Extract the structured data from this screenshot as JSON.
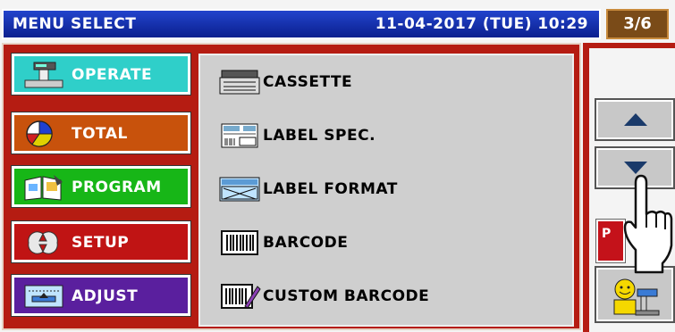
{
  "header": {
    "title": "MENU SELECT",
    "datetime": "11-04-2017 (TUE) 10:29",
    "page_indicator": "3/6"
  },
  "categories": [
    {
      "label": "OPERATE",
      "icon": "scale-icon",
      "color": "#2fcfc9"
    },
    {
      "label": "TOTAL",
      "icon": "pie-chart-icon",
      "color": "#c8520c"
    },
    {
      "label": "PROGRAM",
      "icon": "book-icon",
      "color": "#17b617"
    },
    {
      "label": "SETUP",
      "icon": "wrench-icon",
      "color": "#c01414"
    },
    {
      "label": "ADJUST",
      "icon": "calibration-icon",
      "color": "#5a1f9e"
    }
  ],
  "menu_items": [
    {
      "label": "CASSETTE",
      "icon": "cassette-icon"
    },
    {
      "label": "LABEL SPEC.",
      "icon": "label-spec-icon"
    },
    {
      "label": "LABEL FORMAT",
      "icon": "label-format-icon"
    },
    {
      "label": "BARCODE",
      "icon": "barcode-icon"
    },
    {
      "label": "CUSTOM BARCODE",
      "icon": "custom-barcode-icon"
    }
  ],
  "side_panel": {
    "up_icon": "arrow-up-icon",
    "down_icon": "arrow-down-icon",
    "partial_button_label": "P",
    "operator_icon": "operator-icon"
  },
  "colors": {
    "title_bar": "#1530b0",
    "frame": "#b51c12",
    "list_bg": "#cfcfcf"
  }
}
